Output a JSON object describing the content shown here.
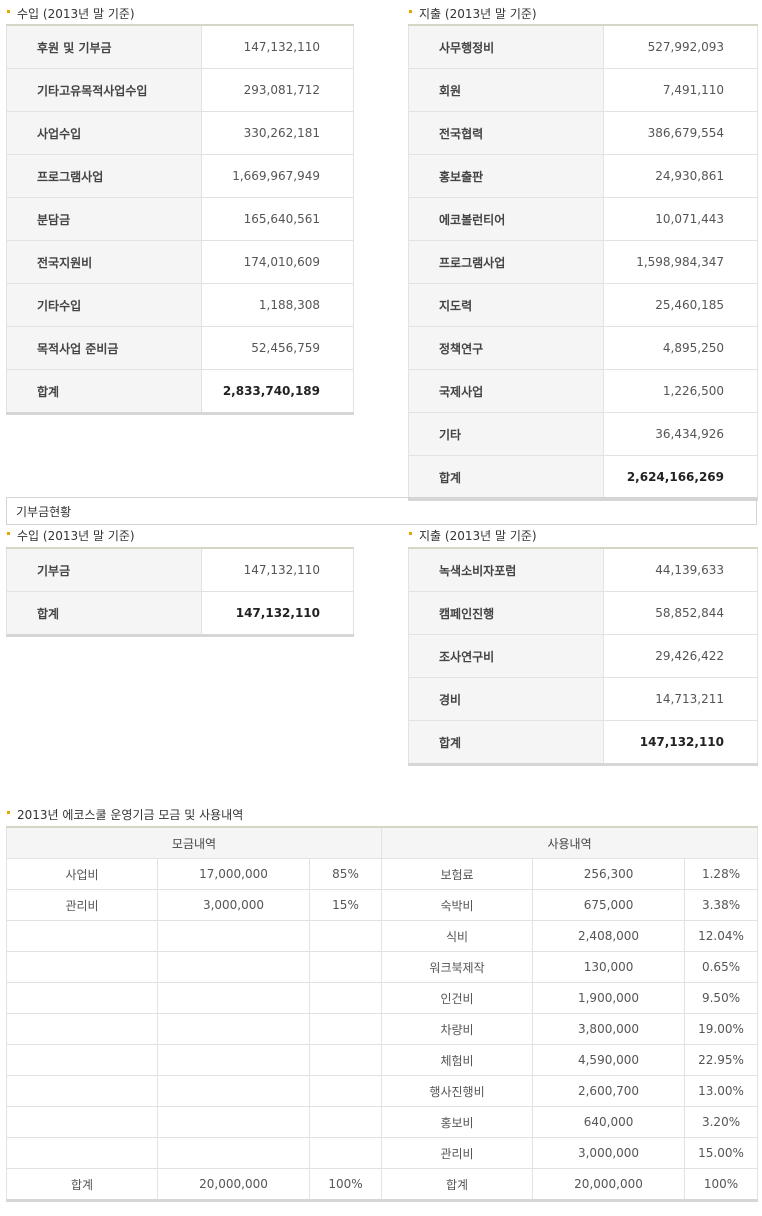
{
  "section1": {
    "income": {
      "title": "수입 (2013년 말 기준)",
      "rows": [
        {
          "label": "후원 및 기부금",
          "value": "147,132,110"
        },
        {
          "label": "기타고유목적사업수입",
          "value": "293,081,712"
        },
        {
          "label": "사업수입",
          "value": "330,262,181"
        },
        {
          "label": "프로그램사업",
          "value": "1,669,967,949"
        },
        {
          "label": "분담금",
          "value": "165,640,561"
        },
        {
          "label": "전국지원비",
          "value": "174,010,609"
        },
        {
          "label": "기타수입",
          "value": "1,188,308"
        },
        {
          "label": "목적사업 준비금",
          "value": "52,456,759"
        },
        {
          "label": "합계",
          "value": "2,833,740,189",
          "total": true
        }
      ]
    },
    "expense": {
      "title": "지출 (2013년 말 기준)",
      "rows": [
        {
          "label": "사무행정비",
          "value": "527,992,093"
        },
        {
          "label": "회원",
          "value": "7,491,110"
        },
        {
          "label": "전국협력",
          "value": "386,679,554"
        },
        {
          "label": "홍보출판",
          "value": "24,930,861"
        },
        {
          "label": "에코볼런티어",
          "value": "10,071,443"
        },
        {
          "label": "프로그램사업",
          "value": "1,598,984,347"
        },
        {
          "label": "지도력",
          "value": "25,460,185"
        },
        {
          "label": "정책연구",
          "value": "4,895,250"
        },
        {
          "label": "국제사업",
          "value": "1,226,500"
        },
        {
          "label": "기타",
          "value": "36,434,926"
        },
        {
          "label": "합계",
          "value": "2,624,166,269",
          "total": true
        }
      ]
    }
  },
  "donation": {
    "title": "기부금현황",
    "income": {
      "title": "수입 (2013년 말 기준)",
      "rows": [
        {
          "label": "기부금",
          "value": "147,132,110"
        },
        {
          "label": "합계",
          "value": "147,132,110",
          "total": true
        }
      ]
    },
    "expense": {
      "title": "지출 (2013년 말 기준)",
      "rows": [
        {
          "label": "녹색소비자포럼",
          "value": "44,139,633"
        },
        {
          "label": "캠페인진행",
          "value": "58,852,844"
        },
        {
          "label": "조사연구비",
          "value": "29,426,422"
        },
        {
          "label": "경비",
          "value": "14,713,211"
        },
        {
          "label": "합계",
          "value": "147,132,110",
          "total": true
        }
      ]
    }
  },
  "ecoschool": {
    "title": "2013년 에코스쿨 운영기금 모금 및 사용내역",
    "headers": {
      "raised": "모금내역",
      "used": "사용내역"
    },
    "rows": [
      [
        "사업비",
        "17,000,000",
        "85%",
        "보험료",
        "256,300",
        "1.28%"
      ],
      [
        "관리비",
        "3,000,000",
        "15%",
        "숙박비",
        "675,000",
        "3.38%"
      ],
      [
        "",
        "",
        "",
        "식비",
        "2,408,000",
        "12.04%"
      ],
      [
        "",
        "",
        "",
        "워크북제작",
        "130,000",
        "0.65%"
      ],
      [
        "",
        "",
        "",
        "인건비",
        "1,900,000",
        "9.50%"
      ],
      [
        "",
        "",
        "",
        "차량비",
        "3,800,000",
        "19.00%"
      ],
      [
        "",
        "",
        "",
        "체험비",
        "4,590,000",
        "22.95%"
      ],
      [
        "",
        "",
        "",
        "행사진행비",
        "2,600,700",
        "13.00%"
      ],
      [
        "",
        "",
        "",
        "홍보비",
        "640,000",
        "3.20%"
      ],
      [
        "",
        "",
        "",
        "관리비",
        "3,000,000",
        "15.00%"
      ]
    ],
    "total": [
      "합계",
      "20,000,000",
      "100%",
      "합계",
      "20,000,000",
      "100%"
    ]
  },
  "colors": {
    "bullet": "#e0a800",
    "header_bg": "#f5f5f5",
    "border": "#e2e2e2"
  }
}
